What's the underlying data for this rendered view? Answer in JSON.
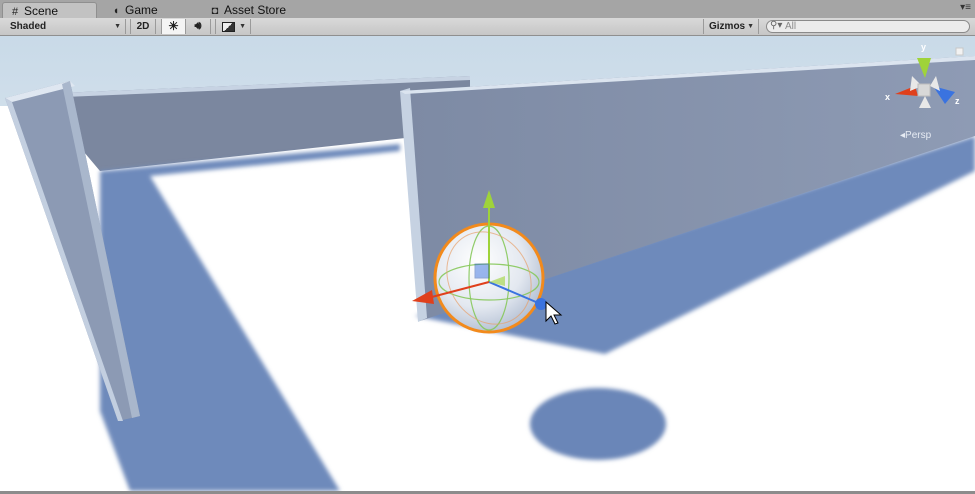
{
  "tabs": [
    {
      "label": "Scene",
      "icon": "grid-icon",
      "active": true
    },
    {
      "label": "Game",
      "icon": "pacman-icon",
      "active": false
    },
    {
      "label": "Asset Store",
      "icon": "bag-icon",
      "active": false
    }
  ],
  "toolbar": {
    "shading_mode": "Shaded",
    "mode_2d": "2D",
    "gizmos_label": "Gizmos",
    "search_placeholder": "All"
  },
  "scene_gizmo": {
    "x_label": "x",
    "y_label": "y",
    "z_label": "z",
    "projection": "Persp",
    "x_color": "#e0401c",
    "y_color": "#9fd33a",
    "z_color": "#3a73e0"
  },
  "colors": {
    "selection_outline": "#f28a1c",
    "sky": "#b7cde0",
    "ground": "#ffffff",
    "shadow": "#6a86b8"
  }
}
